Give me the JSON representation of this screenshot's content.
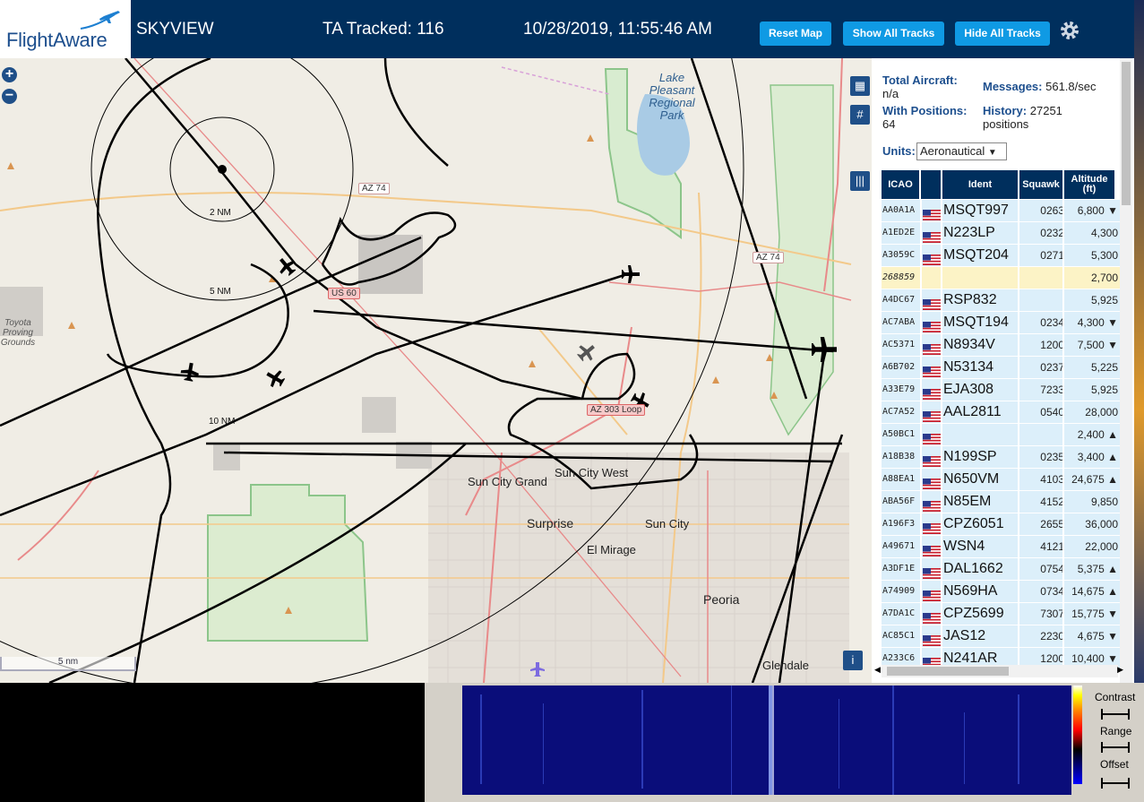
{
  "header": {
    "logo_text": "FlightAware",
    "app_name": "SKYVIEW",
    "ta_tracked": "TA Tracked: 116",
    "datetime": "10/28/2019, 11:55:46 AM",
    "buttons": {
      "reset": "Reset Map",
      "show_all": "Show All Tracks",
      "hide_all": "Hide All Tracks"
    }
  },
  "map": {
    "zoom_in": "+",
    "zoom_out": "−",
    "range_rings": [
      "2 NM",
      "5 NM",
      "10 NM"
    ],
    "places": [
      "Lake Pleasant Regional Park",
      "Toyota Proving Grounds",
      "Sun City Grand",
      "Sun City West",
      "Surprise",
      "Sun City",
      "El Mirage",
      "Peoria",
      "Glendale"
    ],
    "road_labels": [
      "AZ 74",
      "AZ 74",
      "US 60",
      "AZ 303 Loop"
    ],
    "scale": "5 nm",
    "info": "i"
  },
  "stats": {
    "total_aircraft_label": "Total Aircraft:",
    "total_aircraft_value": "n/a",
    "messages_label": "Messages:",
    "messages_value": "561.8/sec",
    "with_positions_label": "With Positions:",
    "with_positions_value": "64",
    "history_label": "History:",
    "history_value": "27251",
    "history_unit": "positions"
  },
  "units": {
    "label": "Units:",
    "selected": "Aeronautical"
  },
  "table": {
    "columns": [
      "ICAO",
      "Ident",
      "Squawk",
      "Altitude (ft)"
    ],
    "rows": [
      {
        "icao": "AA0A1A",
        "flag": true,
        "ident": "MSQT997",
        "squawk": "0263",
        "alt": "6,800 ▼"
      },
      {
        "icao": "A1ED2E",
        "flag": true,
        "ident": "N223LP",
        "squawk": "0232",
        "alt": "4,300"
      },
      {
        "icao": "A3059C",
        "flag": true,
        "ident": "MSQT204",
        "squawk": "0271",
        "alt": "5,300"
      },
      {
        "icao": "268859",
        "flag": false,
        "ident": "",
        "squawk": "",
        "alt": "2,700",
        "highlight": true
      },
      {
        "icao": "A4DC67",
        "flag": true,
        "ident": "RSP832",
        "squawk": "",
        "alt": "5,925"
      },
      {
        "icao": "AC7ABA",
        "flag": true,
        "ident": "MSQT194",
        "squawk": "0234",
        "alt": "4,300 ▼"
      },
      {
        "icao": "AC5371",
        "flag": true,
        "ident": "N8934V",
        "squawk": "1200",
        "alt": "7,500 ▼"
      },
      {
        "icao": "A6B702",
        "flag": true,
        "ident": "N53134",
        "squawk": "0237",
        "alt": "5,225"
      },
      {
        "icao": "A33E79",
        "flag": true,
        "ident": "EJA308",
        "squawk": "7233",
        "alt": "5,925"
      },
      {
        "icao": "AC7A52",
        "flag": true,
        "ident": "AAL2811",
        "squawk": "0540",
        "alt": "28,000"
      },
      {
        "icao": "A50BC1",
        "flag": true,
        "ident": "",
        "squawk": "",
        "alt": "2,400 ▲"
      },
      {
        "icao": "A18B38",
        "flag": true,
        "ident": "N199SP",
        "squawk": "0235",
        "alt": "3,400 ▲"
      },
      {
        "icao": "A88EA1",
        "flag": true,
        "ident": "N650VM",
        "squawk": "4103",
        "alt": "24,675 ▲"
      },
      {
        "icao": "ABA56F",
        "flag": true,
        "ident": "N85EM",
        "squawk": "4152",
        "alt": "9,850"
      },
      {
        "icao": "A196F3",
        "flag": true,
        "ident": "CPZ6051",
        "squawk": "2655",
        "alt": "36,000"
      },
      {
        "icao": "A49671",
        "flag": true,
        "ident": "WSN4",
        "squawk": "4121",
        "alt": "22,000"
      },
      {
        "icao": "A3DF1E",
        "flag": true,
        "ident": "DAL1662",
        "squawk": "0754",
        "alt": "5,375 ▲"
      },
      {
        "icao": "A74909",
        "flag": true,
        "ident": "N569HA",
        "squawk": "0734",
        "alt": "14,675 ▲"
      },
      {
        "icao": "A7DA1C",
        "flag": true,
        "ident": "CPZ5699",
        "squawk": "7307",
        "alt": "15,775 ▼"
      },
      {
        "icao": "AC85C1",
        "flag": true,
        "ident": "JAS12",
        "squawk": "2230",
        "alt": "4,675 ▼"
      },
      {
        "icao": "A233C6",
        "flag": true,
        "ident": "N241AR",
        "squawk": "1200",
        "alt": "10,400 ▼"
      }
    ]
  },
  "spectrum": {
    "contrast": "Contrast",
    "range": "Range",
    "offset": "Offset"
  },
  "colors": {
    "header": "#002f5d",
    "button": "#0f9ae4",
    "row": "#dceffa",
    "highlight_row": "#fcf3c6"
  }
}
